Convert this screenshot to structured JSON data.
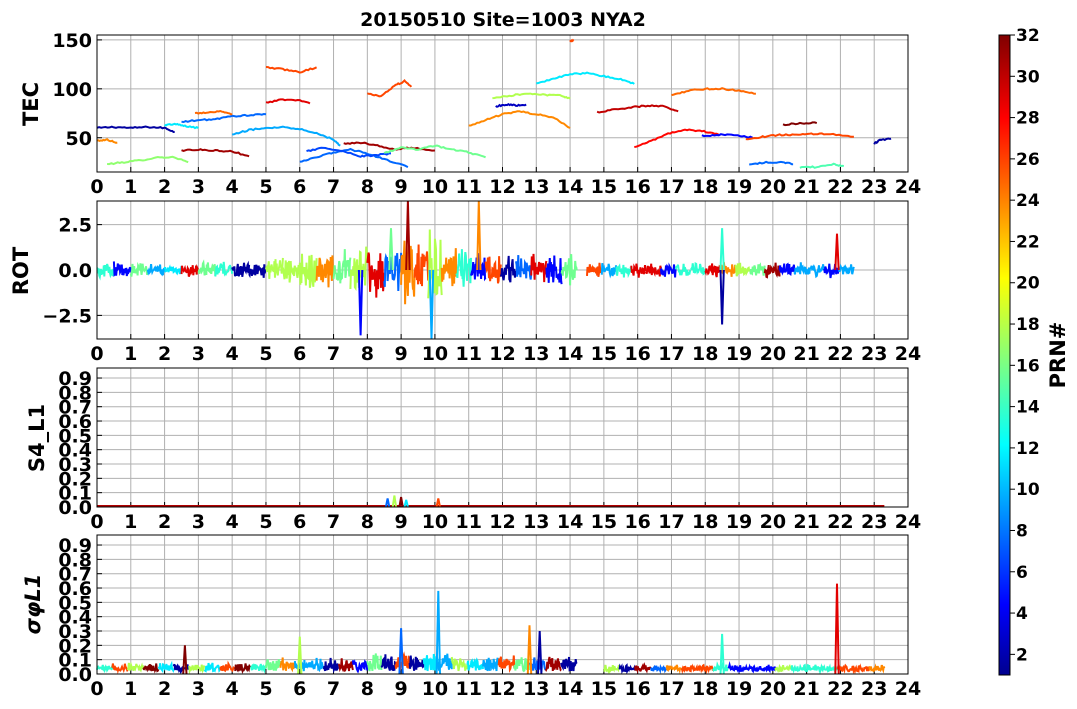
{
  "chart_data": {
    "title": "20150510 Site=1003 NYA2",
    "colorbar": {
      "label": "PRN#",
      "colormap": "jet",
      "range": [
        1,
        32
      ],
      "ticks": [
        "2",
        "4",
        "6",
        "8",
        "10",
        "12",
        "14",
        "16",
        "18",
        "20",
        "22",
        "24",
        "26",
        "28",
        "30",
        "32"
      ]
    },
    "x_ticks": [
      "0",
      "1",
      "2",
      "3",
      "4",
      "5",
      "6",
      "7",
      "8",
      "9",
      "10",
      "11",
      "12",
      "13",
      "14",
      "15",
      "16",
      "17",
      "18",
      "19",
      "20",
      "21",
      "22",
      "23",
      "24"
    ],
    "xlim": [
      0,
      24
    ],
    "panels": [
      {
        "type": "line",
        "ylabel": "TEC",
        "ylim": [
          15,
          155
        ],
        "yticks": [
          50,
          100,
          150
        ],
        "ytick_labels": [
          "50",
          "100",
          "150"
        ],
        "grid": true,
        "series": [
          {
            "prn": 2,
            "x": [
              0,
              0.5,
              1,
              1.5,
              2,
              2.3
            ],
            "y": [
              60,
              61,
              60,
              61,
              60,
              56
            ]
          },
          {
            "prn": 17,
            "x": [
              0.3,
              0.8,
              1.3,
              1.8,
              2.3,
              2.7
            ],
            "y": [
              23,
              25,
              27,
              30,
              30,
              25
            ]
          },
          {
            "prn": 24,
            "x": [
              0,
              0.3,
              0.6
            ],
            "y": [
              47,
              48,
              45
            ]
          },
          {
            "prn": 12,
            "x": [
              2,
              2.3,
              2.6,
              3
            ],
            "y": [
              63,
              64,
              62,
              60
            ]
          },
          {
            "prn": 8,
            "x": [
              2.5,
              3,
              3.5,
              4,
              4.5,
              5
            ],
            "y": [
              66,
              68,
              69,
              72,
              73,
              74
            ]
          },
          {
            "prn": 25,
            "x": [
              2.9,
              3.3,
              3.7,
              4
            ],
            "y": [
              75,
              76,
              77,
              74
            ]
          },
          {
            "prn": 31,
            "x": [
              2.5,
              3,
              3.5,
              4,
              4.5
            ],
            "y": [
              37,
              38,
              37,
              36,
              31
            ]
          },
          {
            "prn": 10,
            "x": [
              4,
              4.5,
              5,
              5.5,
              6,
              6.5,
              7,
              7.2
            ],
            "y": [
              53,
              58,
              60,
              61,
              59,
              55,
              48,
              42
            ]
          },
          {
            "prn": 26,
            "x": [
              5,
              5.5,
              6,
              6.5
            ],
            "y": [
              122,
              120,
              117,
              122
            ]
          },
          {
            "prn": 29,
            "x": [
              5,
              5.5,
              6,
              6.3
            ],
            "y": [
              86,
              89,
              88,
              85
            ]
          },
          {
            "prn": 8,
            "x": [
              6,
              6.5,
              7,
              7.5,
              8,
              8.5,
              9.2
            ],
            "y": [
              25,
              30,
              35,
              38,
              34,
              28,
              20
            ]
          },
          {
            "prn": 7,
            "x": [
              6.2,
              6.7,
              7.2,
              7.8,
              8.2,
              8.7
            ],
            "y": [
              36,
              40,
              37,
              31,
              32,
              34
            ]
          },
          {
            "prn": 31,
            "x": [
              7.3,
              7.8,
              8.3,
              8.8,
              9.3,
              10
            ],
            "y": [
              44,
              45,
              42,
              38,
              40,
              37
            ]
          },
          {
            "prn": 26,
            "x": [
              8,
              8.4,
              8.8,
              9.1,
              9.3
            ],
            "y": [
              95,
              92,
              103,
              108,
              102
            ]
          },
          {
            "prn": 16,
            "x": [
              8.5,
              9,
              9.5,
              10,
              10.5,
              11,
              11.5
            ],
            "y": [
              34,
              40,
              38,
              42,
              38,
              35,
              30
            ]
          },
          {
            "prn": 24,
            "x": [
              11,
              11.5,
              12,
              12.5,
              13,
              13.5,
              14
            ],
            "y": [
              62,
              68,
              74,
              77,
              74,
              71,
              60
            ]
          },
          {
            "prn": 18,
            "x": [
              11.7,
              12.2,
              12.7,
              13.2,
              13.7,
              14
            ],
            "y": [
              90,
              93,
              95,
              94,
              93,
              90
            ]
          },
          {
            "prn": 3,
            "x": [
              11.8,
              12.1,
              12.4,
              12.7
            ],
            "y": [
              82,
              84,
              83,
              84
            ]
          },
          {
            "prn": 26,
            "x": [
              14,
              14.1
            ],
            "y": [
              149,
              149
            ]
          },
          {
            "prn": 12,
            "x": [
              13,
              13.5,
              14,
              14.5,
              15,
              15.5,
              15.9
            ],
            "y": [
              105,
              110,
              115,
              116,
              113,
              110,
              105
            ]
          },
          {
            "prn": 30,
            "x": [
              14.8,
              15.3,
              15.8,
              16.3,
              16.8,
              17.2
            ],
            "y": [
              76,
              79,
              81,
              83,
              82,
              77
            ]
          },
          {
            "prn": 28,
            "x": [
              15.9,
              16.4,
              16.9,
              17.4,
              17.9,
              18.4
            ],
            "y": [
              40,
              47,
              54,
              58,
              57,
              53
            ]
          },
          {
            "prn": 25,
            "x": [
              17,
              17.5,
              18,
              18.5,
              19,
              19.5
            ],
            "y": [
              93,
              98,
              100,
              100,
              98,
              95
            ]
          },
          {
            "prn": 5,
            "x": [
              17.9,
              18.4,
              18.9,
              19.4
            ],
            "y": [
              52,
              53,
              53,
              50
            ]
          },
          {
            "prn": 26,
            "x": [
              19.2,
              19.7,
              20.2,
              20.7,
              21.2,
              21.7,
              22.4
            ],
            "y": [
              48,
              51,
              53,
              53,
              54,
              54,
              51
            ]
          },
          {
            "prn": 8,
            "x": [
              19.3,
              19.8,
              20.3,
              20.6
            ],
            "y": [
              22,
              25,
              25,
              23
            ]
          },
          {
            "prn": 32,
            "x": [
              20.3,
              20.8,
              21.3
            ],
            "y": [
              63,
              65,
              65
            ]
          },
          {
            "prn": 15,
            "x": [
              20.8,
              21.3,
              21.8,
              22.1
            ],
            "y": [
              20,
              20,
              23,
              21
            ]
          },
          {
            "prn": 2,
            "x": [
              23,
              23.2,
              23.5
            ],
            "y": [
              44,
              48,
              49
            ]
          }
        ]
      },
      {
        "type": "line",
        "ylabel": "ROT",
        "ylim": [
          -3.8,
          3.8
        ],
        "yticks": [
          -2.5,
          0,
          2.5
        ],
        "ytick_labels": [
          "−2.5",
          "0.0",
          "2.5"
        ],
        "grid": true,
        "activity": [
          {
            "start": 0,
            "end": 1,
            "amp": 0.5
          },
          {
            "start": 1,
            "end": 3,
            "amp": 0.4
          },
          {
            "start": 3,
            "end": 5,
            "amp": 0.5
          },
          {
            "start": 5,
            "end": 6,
            "amp": 0.8
          },
          {
            "start": 6,
            "end": 7.5,
            "amp": 1.2
          },
          {
            "start": 7.5,
            "end": 9,
            "amp": 1.7
          },
          {
            "start": 9,
            "end": 10.2,
            "amp": 2.6
          },
          {
            "start": 10.2,
            "end": 11.5,
            "amp": 1.4
          },
          {
            "start": 11.5,
            "end": 14.2,
            "amp": 1.0
          },
          {
            "start": 14.5,
            "end": 18,
            "amp": 0.45
          },
          {
            "start": 18,
            "end": 22.4,
            "amp": 0.45
          }
        ],
        "spikes": [
          {
            "x": 7.8,
            "y": -3.6
          },
          {
            "x": 8.7,
            "y": 2.3
          },
          {
            "x": 9.2,
            "y": 3.8
          },
          {
            "x": 9.9,
            "y": -3.8
          },
          {
            "x": 11.3,
            "y": 3.8
          },
          {
            "x": 18.5,
            "y": -3.0
          },
          {
            "x": 18.5,
            "y": 2.3
          },
          {
            "x": 21.9,
            "y": 2.0
          }
        ]
      },
      {
        "type": "line",
        "ylabel": "S4_L1",
        "ylim": [
          0,
          0.97
        ],
        "yticks": [
          0,
          0.1,
          0.2,
          0.3,
          0.4,
          0.5,
          0.6,
          0.7,
          0.8,
          0.9
        ],
        "ytick_labels": [
          "0.0",
          "0.1",
          "0.2",
          "0.3",
          "0.4",
          "0.5",
          "0.6",
          "0.7",
          "0.8",
          "0.9"
        ],
        "grid": true,
        "baseline": 0.005,
        "spikes": [
          {
            "x": 8.6,
            "y": 0.06
          },
          {
            "x": 8.8,
            "y": 0.08
          },
          {
            "x": 9.0,
            "y": 0.07
          },
          {
            "x": 9.15,
            "y": 0.05
          },
          {
            "x": 10.1,
            "y": 0.06
          }
        ]
      },
      {
        "type": "line",
        "ylabel": "σφL1",
        "ylim": [
          0,
          0.97
        ],
        "yticks": [
          0,
          0.1,
          0.2,
          0.3,
          0.4,
          0.5,
          0.6,
          0.7,
          0.8,
          0.9
        ],
        "ytick_labels": [
          "0.0",
          "0.1",
          "0.2",
          "0.3",
          "0.4",
          "0.5",
          "0.6",
          "0.7",
          "0.8",
          "0.9"
        ],
        "grid": true,
        "activity": [
          {
            "start": 0,
            "end": 5,
            "amp": 0.06
          },
          {
            "start": 5,
            "end": 8,
            "amp": 0.1
          },
          {
            "start": 8,
            "end": 10.5,
            "amp": 0.15
          },
          {
            "start": 10.5,
            "end": 14.2,
            "amp": 0.12
          },
          {
            "start": 15,
            "end": 23.3,
            "amp": 0.05
          }
        ],
        "spikes": [
          {
            "x": 10.1,
            "y": 0.58
          },
          {
            "x": 12.8,
            "y": 0.34
          },
          {
            "x": 13.1,
            "y": 0.3
          },
          {
            "x": 18.5,
            "y": 0.28
          },
          {
            "x": 21.9,
            "y": 0.63
          },
          {
            "x": 9.0,
            "y": 0.32
          },
          {
            "x": 6.0,
            "y": 0.26
          },
          {
            "x": 2.6,
            "y": 0.2
          }
        ]
      }
    ]
  }
}
